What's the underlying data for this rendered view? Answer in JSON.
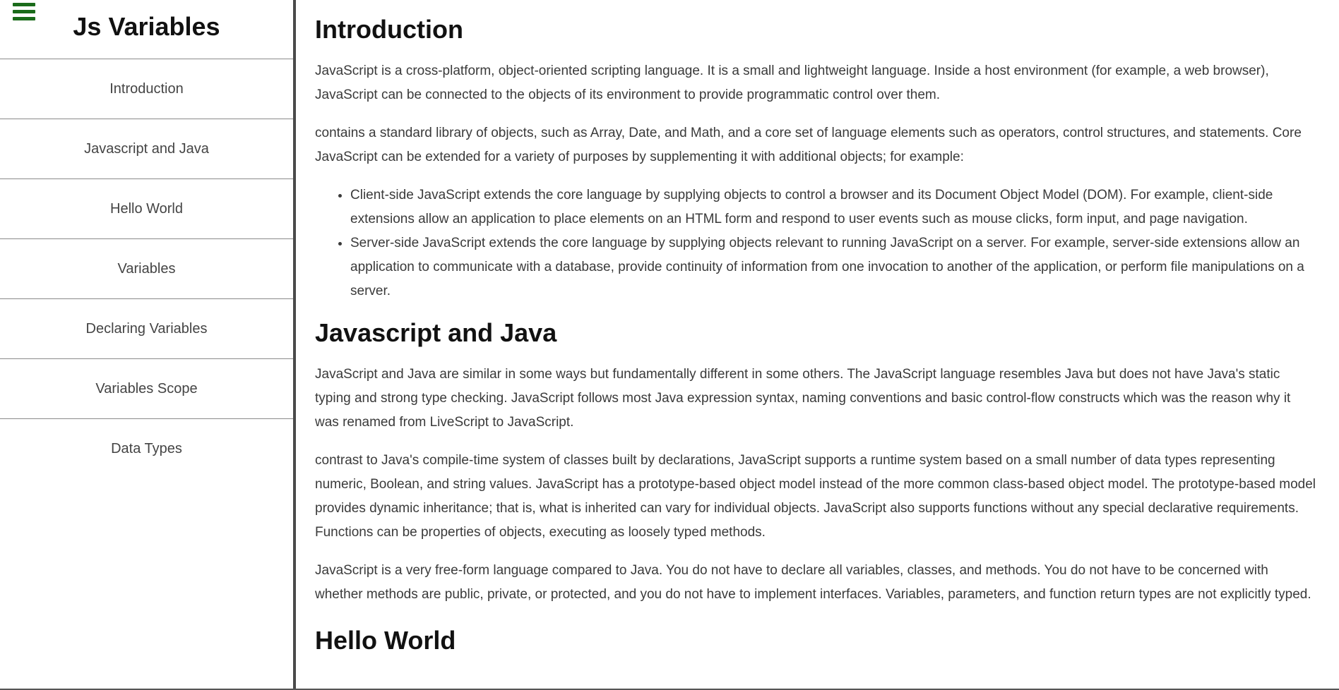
{
  "sidebar": {
    "title": "Js Variables",
    "menu_icon": "hamburger-menu-icon",
    "items": [
      {
        "label": "Introduction"
      },
      {
        "label": "Javascript and Java"
      },
      {
        "label": "Hello World"
      },
      {
        "label": "Variables"
      },
      {
        "label": "Declaring Variables"
      },
      {
        "label": "Variables Scope"
      },
      {
        "label": "Data Types"
      }
    ]
  },
  "main": {
    "sections": [
      {
        "title": "Introduction",
        "paragraphs": [
          "JavaScript is a cross-platform, object-oriented scripting language. It is a small and lightweight language. Inside a host environment (for example, a web browser), JavaScript can be connected to the objects of its environment to provide programmatic control over them.",
          "contains a standard library of objects, such as Array, Date, and Math, and a core set of language elements such as operators, control structures, and statements. Core JavaScript can be extended for a variety of purposes by supplementing it with additional objects; for example:"
        ],
        "bullets": [
          "Client-side JavaScript extends the core language by supplying objects to control a browser and its Document Object Model (DOM). For example, client-side extensions allow an application to place elements on an HTML form and respond to user events such as mouse clicks, form input, and page navigation.",
          "Server-side JavaScript extends the core language by supplying objects relevant to running JavaScript on a server. For example, server-side extensions allow an application to communicate with a database, provide continuity of information from one invocation to another of the application, or perform file manipulations on a server."
        ]
      },
      {
        "title": "Javascript and Java",
        "paragraphs": [
          "JavaScript and Java are similar in some ways but fundamentally different in some others. The JavaScript language resembles Java but does not have Java's static typing and strong type checking. JavaScript follows most Java expression syntax, naming conventions and basic control-flow constructs which was the reason why it was renamed from LiveScript to JavaScript.",
          "contrast to Java's compile-time system of classes built by declarations, JavaScript supports a runtime system based on a small number of data types representing numeric, Boolean, and string values. JavaScript has a prototype-based object model instead of the more common class-based object model. The prototype-based model provides dynamic inheritance; that is, what is inherited can vary for individual objects. JavaScript also supports functions without any special declarative requirements. Functions can be properties of objects, executing as loosely typed methods.",
          "JavaScript is a very free-form language compared to Java. You do not have to declare all variables, classes, and methods. You do not have to be concerned with whether methods are public, private, or protected, and you do not have to implement interfaces. Variables, parameters, and function return types are not explicitly typed."
        ]
      },
      {
        "title": "Hello World"
      }
    ]
  },
  "colors": {
    "menu_icon": "#1a6b1a",
    "sidebar_border": "#4a4a4a",
    "divider": "#8a8a8a"
  }
}
